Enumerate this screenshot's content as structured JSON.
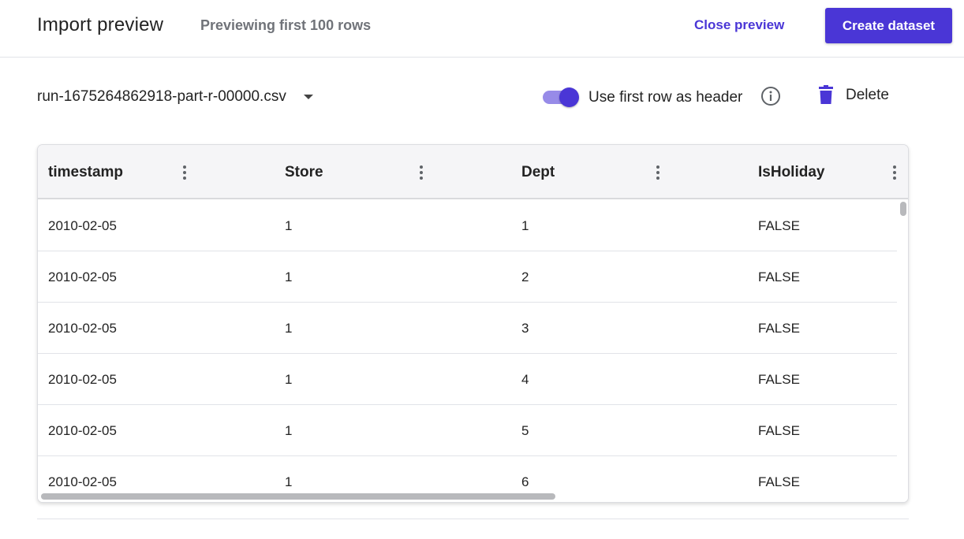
{
  "header": {
    "title": "Import preview",
    "subtitle": "Previewing first 100 rows",
    "close_label": "Close preview",
    "create_label": "Create dataset"
  },
  "toolbar": {
    "file_name": "run-1675264862918-part-r-00000.csv",
    "header_toggle_label": "Use first row as header",
    "header_toggle_on": true,
    "delete_label": "Delete"
  },
  "table": {
    "columns": [
      "timestamp",
      "Store",
      "Dept",
      "IsHoliday"
    ],
    "rows": [
      [
        "2010-02-05",
        "1",
        "1",
        "FALSE"
      ],
      [
        "2010-02-05",
        "1",
        "2",
        "FALSE"
      ],
      [
        "2010-02-05",
        "1",
        "3",
        "FALSE"
      ],
      [
        "2010-02-05",
        "1",
        "4",
        "FALSE"
      ],
      [
        "2010-02-05",
        "1",
        "5",
        "FALSE"
      ],
      [
        "2010-02-05",
        "1",
        "6",
        "FALSE"
      ]
    ]
  },
  "colors": {
    "accent": "#4a36d6",
    "toggle_track": "#978be8",
    "muted_text": "#707379"
  },
  "icons": {
    "file_dropdown": "caret-down-icon",
    "info": "info-icon",
    "delete": "trash-icon",
    "column_menu": "more-vertical-icon"
  }
}
